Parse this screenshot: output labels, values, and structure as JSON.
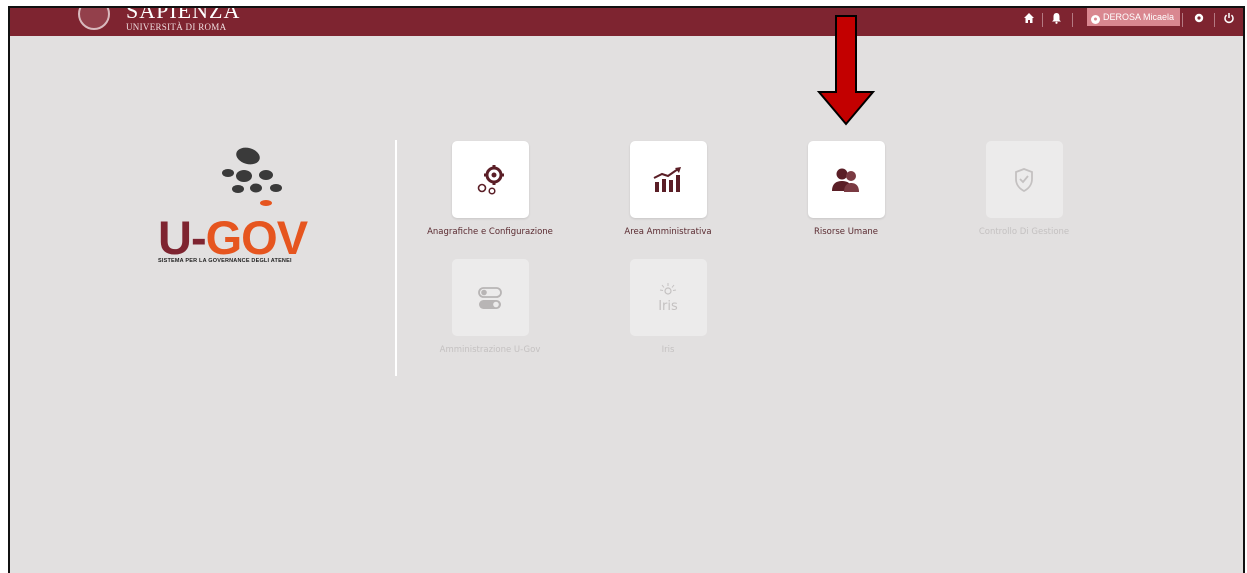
{
  "header": {
    "brand_name": "SAPIENZA",
    "brand_subtitle": "UNIVERSITÀ DI ROMA",
    "user_name": "DEROSA Micaela",
    "colors": {
      "bar": "#7e2430",
      "user_badge": "#d98790"
    },
    "icons": [
      "home-icon",
      "bell-icon",
      "user-icon",
      "gear-icon",
      "power-icon"
    ]
  },
  "logo": {
    "u": "U-",
    "gov": "GOV",
    "tagline": "SISTEMA PER LA GOVERNANCE DEGLI ATENEI",
    "colors": {
      "u": "#7e2430",
      "gov": "#e6551f"
    }
  },
  "tiles": [
    {
      "label": "Anagrafiche e Configurazione",
      "icon": "gears-icon",
      "enabled": true
    },
    {
      "label": "Area Amministrativa",
      "icon": "chart-growth-icon",
      "enabled": true
    },
    {
      "label": "Risorse Umane",
      "icon": "users-icon",
      "enabled": true
    },
    {
      "label": "Controllo Di Gestione",
      "icon": "shield-check-icon",
      "enabled": false
    },
    {
      "label": "Amministrazione U-Gov",
      "icon": "toggles-icon",
      "enabled": false
    },
    {
      "label": "Iris",
      "icon": "iris-logo-icon",
      "enabled": false
    }
  ],
  "annotation": {
    "icon": "red-arrow-down-icon",
    "color": "#c30000"
  }
}
